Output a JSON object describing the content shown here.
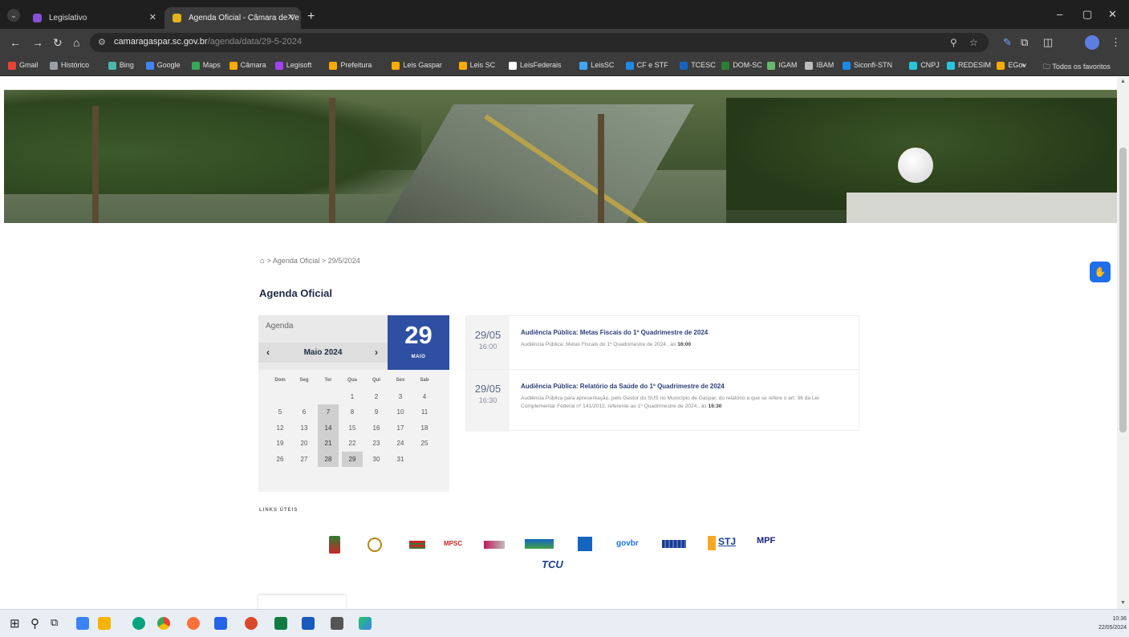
{
  "browser": {
    "tabs": [
      {
        "title": "Legislativo",
        "active": false
      },
      {
        "title": "Agenda Oficial - Câmara de Ve",
        "active": true
      }
    ],
    "url_host": "camaragaspar.sc.gov.br",
    "url_path": "/agenda/data/29-5-2024",
    "bookmarks": [
      "Gmail",
      "Histórico",
      "Bing",
      "Google",
      "Maps",
      "Câmara",
      "Legisoft",
      "Prefeitura",
      "Leis Gaspar",
      "Leis SC",
      "LeisFederais",
      "LeisSC",
      "CF e STF",
      "TCESC",
      "DOM-SC",
      "IGAM",
      "IBAM",
      "Siconfi-STN",
      "CNPJ",
      "REDESIM",
      "EGov"
    ],
    "bookmarks_more": "»",
    "all_bookmarks": "Todos os favoritos"
  },
  "breadcrumb": {
    "home_icon": "home-icon",
    "sep": ">",
    "items": [
      "Agenda Oficial",
      "29/5/2024"
    ]
  },
  "page_title": "Agenda Oficial",
  "calendar": {
    "label": "Agenda",
    "prev": "‹",
    "next": "›",
    "month_label": "Maio 2024",
    "big_day": "29",
    "big_month": "MAIO",
    "weekdays": [
      "Dom",
      "Seg",
      "Ter",
      "Qua",
      "Qui",
      "Sex",
      "Sab"
    ],
    "weeks": [
      [
        "",
        "",
        "",
        "1",
        "2",
        "3",
        "4"
      ],
      [
        "5",
        "6",
        "7",
        "8",
        "9",
        "10",
        "11"
      ],
      [
        "12",
        "13",
        "14",
        "15",
        "16",
        "17",
        "18"
      ],
      [
        "19",
        "20",
        "21",
        "22",
        "23",
        "24",
        "25"
      ],
      [
        "26",
        "27",
        "28",
        "29",
        "30",
        "31",
        ""
      ]
    ],
    "event_days": [
      "7",
      "14",
      "21",
      "28",
      "29"
    ]
  },
  "events": [
    {
      "date": "29/05",
      "time": "16:00",
      "title": "Audiência Pública: Metas Fiscais do 1º Quadrimestre de 2024",
      "desc": "Audiência Pública: Metas Fiscais do 1º Quadrimestre de 2024 , às",
      "desc_time": "16:00"
    },
    {
      "date": "29/05",
      "time": "16:30",
      "title": "Audiência Pública: Relatório da Saúde do 1º Quadrimestre de 2024",
      "desc": "Audiência Pública para apresentação, pelo Gestor do SUS no Município de Gaspar, do relatório a que se refere o art. 36 da Lei Complementar Federal nº 141/2012, referente ao 1º Quadrimestre de 2024., às",
      "desc_time": "16:30"
    }
  ],
  "links_title": "LINKS ÚTEIS",
  "logos": [
    "MPSC",
    "govbr",
    "STJ",
    "MPF",
    "TCU"
  ],
  "clock": {
    "time": "10:36",
    "date": "22/05/2024"
  }
}
